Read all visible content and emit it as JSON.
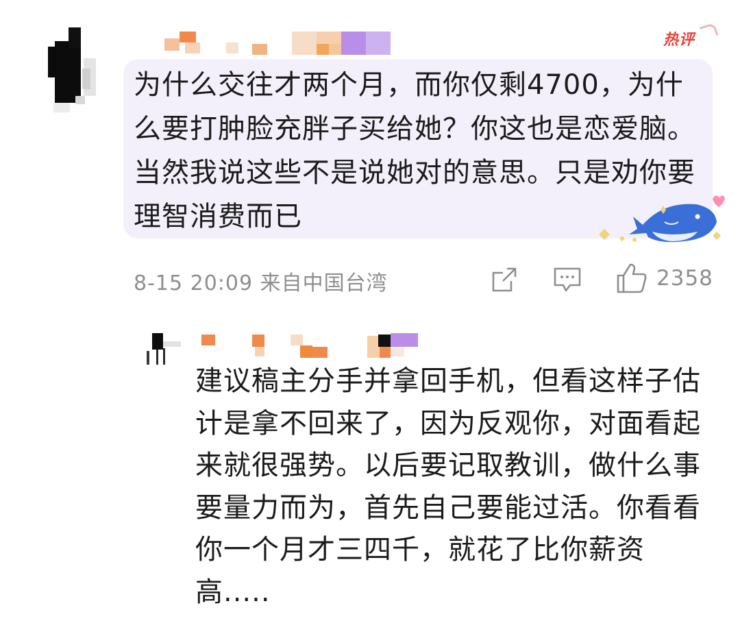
{
  "comment": {
    "badge": "热评",
    "text": "为什么交往才两个月，而你仅剩4700，为什么要打肿脸充胖子买给她？你这也是恋爱脑。当然我说这些不是说她对的意思。只是劝你要理智消费而已",
    "meta": "8-15 20:09 来自中国台湾",
    "likes": "2358",
    "icons": {
      "share": "share-icon",
      "comment": "comment-icon",
      "like": "thumbs-up-icon"
    }
  },
  "reply": {
    "text": "建议稿主分手并拿回手机，但看这样子估计是拿不回来了，因为反观你，对面看起来就很强势。以后要记取教训，做什么事要量力而为，首先自己要能过活。你看看你一个月才三四千，就花了比你薪资高....."
  },
  "colors": {
    "bubble": "#f4f0fb",
    "badge": "#e8433a",
    "meta": "#8e8e8e",
    "text": "#1b1b1b"
  }
}
